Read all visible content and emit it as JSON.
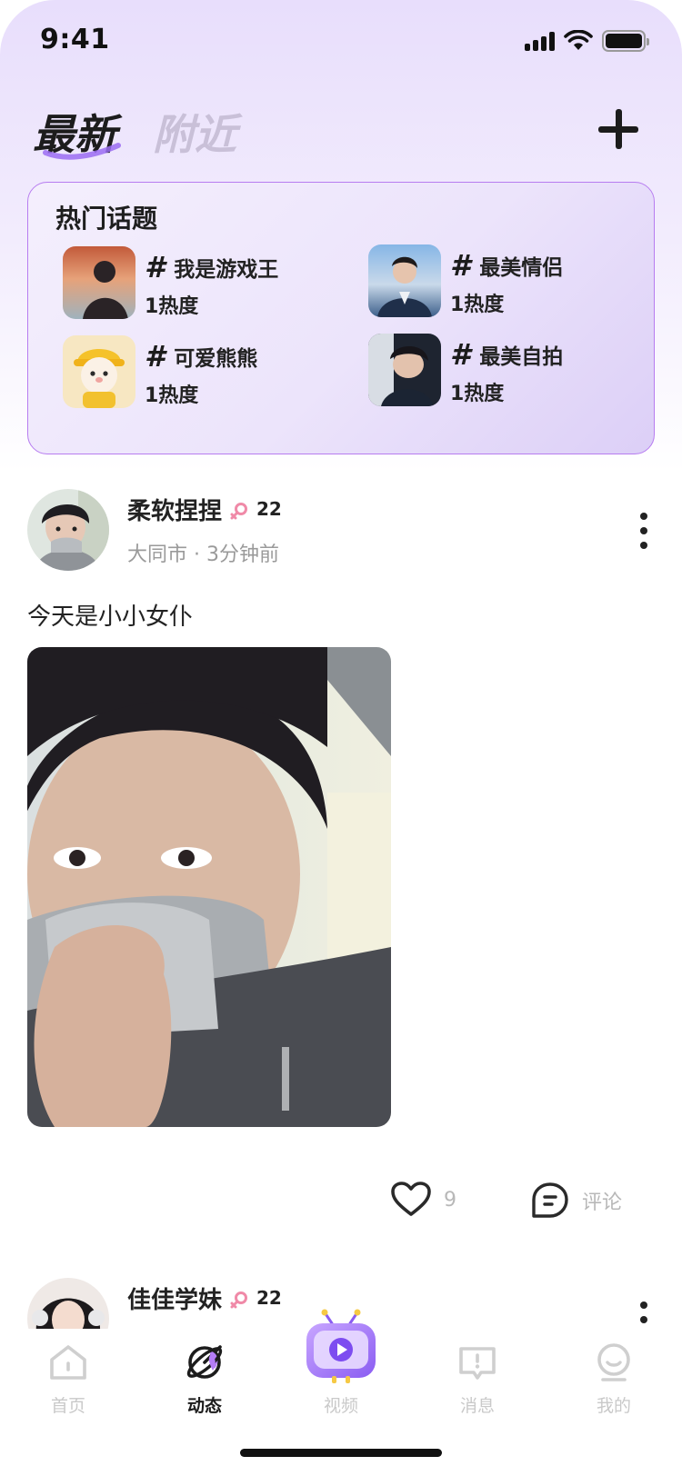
{
  "status_bar": {
    "time": "9:41"
  },
  "tabs": [
    {
      "label": "最新",
      "active": true
    },
    {
      "label": "附近",
      "active": false
    }
  ],
  "hot_topics": {
    "title": "热门话题",
    "items": [
      {
        "name": "我是游戏王",
        "heat": "1热度"
      },
      {
        "name": "最美情侣",
        "heat": "1热度"
      },
      {
        "name": "可爱熊熊",
        "heat": "1热度"
      },
      {
        "name": "最美自拍",
        "heat": "1热度"
      }
    ]
  },
  "post": {
    "username": "柔软捏捏",
    "age": "22",
    "meta": "大同市 · 3分钟前",
    "text": "今天是小小女仆",
    "like_count": "9",
    "comment_label": "评论"
  },
  "post2": {
    "username": "佳佳学妹",
    "age": "22"
  },
  "tabbar": {
    "items": [
      {
        "label": "首页",
        "icon": "home-icon"
      },
      {
        "label": "动态",
        "icon": "planet-icon",
        "active": true
      },
      {
        "label": "视频",
        "icon": "tv-icon"
      },
      {
        "label": "消息",
        "icon": "message-icon"
      },
      {
        "label": "我的",
        "icon": "profile-icon"
      }
    ]
  },
  "colors": {
    "accent": "#b77cf0",
    "female_symbol": "#f08aa8",
    "inactive_tab": "#c9c0d8",
    "muted_text": "#9a9a9a"
  }
}
